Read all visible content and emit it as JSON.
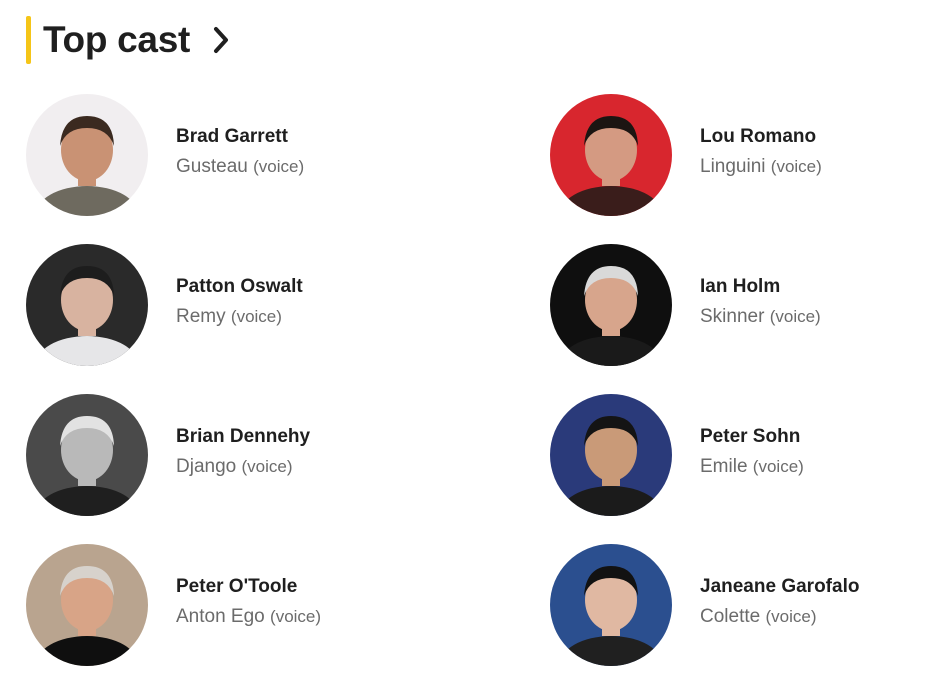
{
  "section": {
    "title": "Top cast",
    "accent_color": "#f5c518",
    "chevron_icon": "chevron-right-icon"
  },
  "cast": [
    {
      "name": "Brad Garrett",
      "character": "Gusteau",
      "note": "(voice)",
      "photo": {
        "bg": "#f1eef0",
        "skin": "#c99274",
        "hair": "#3b2a20",
        "shirt": "#6e6a5f"
      }
    },
    {
      "name": "Lou Romano",
      "character": "Linguini",
      "note": "(voice)",
      "photo": {
        "bg": "#d8262e",
        "skin": "#d49a82",
        "hair": "#1c1512",
        "shirt": "#3a1d1b"
      }
    },
    {
      "name": "Patton Oswalt",
      "character": "Remy",
      "note": "(voice)",
      "photo": {
        "bg": "#2a2a2a",
        "skin": "#d8b3a0",
        "hair": "#1d1d1d",
        "shirt": "#e6e6e8"
      }
    },
    {
      "name": "Ian Holm",
      "character": "Skinner",
      "note": "(voice)",
      "photo": {
        "bg": "#0f0f0f",
        "skin": "#d7a58c",
        "hair": "#d9d9d9",
        "shirt": "#1a1a1a"
      }
    },
    {
      "name": "Brian Dennehy",
      "character": "Django",
      "note": "(voice)",
      "photo": {
        "bg": "#4a4a4a",
        "skin": "#b9b9b9",
        "hair": "#e2e2e2",
        "shirt": "#1f1f1f"
      }
    },
    {
      "name": "Peter Sohn",
      "character": "Emile",
      "note": "(voice)",
      "photo": {
        "bg": "#2a3a7a",
        "skin": "#c99a78",
        "hair": "#141414",
        "shirt": "#1b1b1b"
      }
    },
    {
      "name": "Peter O'Toole",
      "character": "Anton Ego",
      "note": "(voice)",
      "photo": {
        "bg": "#b9a48f",
        "skin": "#d8a487",
        "hair": "#d7d2cc",
        "shirt": "#0f0f0f"
      }
    },
    {
      "name": "Janeane Garofalo",
      "character": "Colette",
      "note": "(voice)",
      "photo": {
        "bg": "#2b4f8f",
        "skin": "#e0b8a2",
        "hair": "#121212",
        "shirt": "#202020"
      }
    }
  ]
}
